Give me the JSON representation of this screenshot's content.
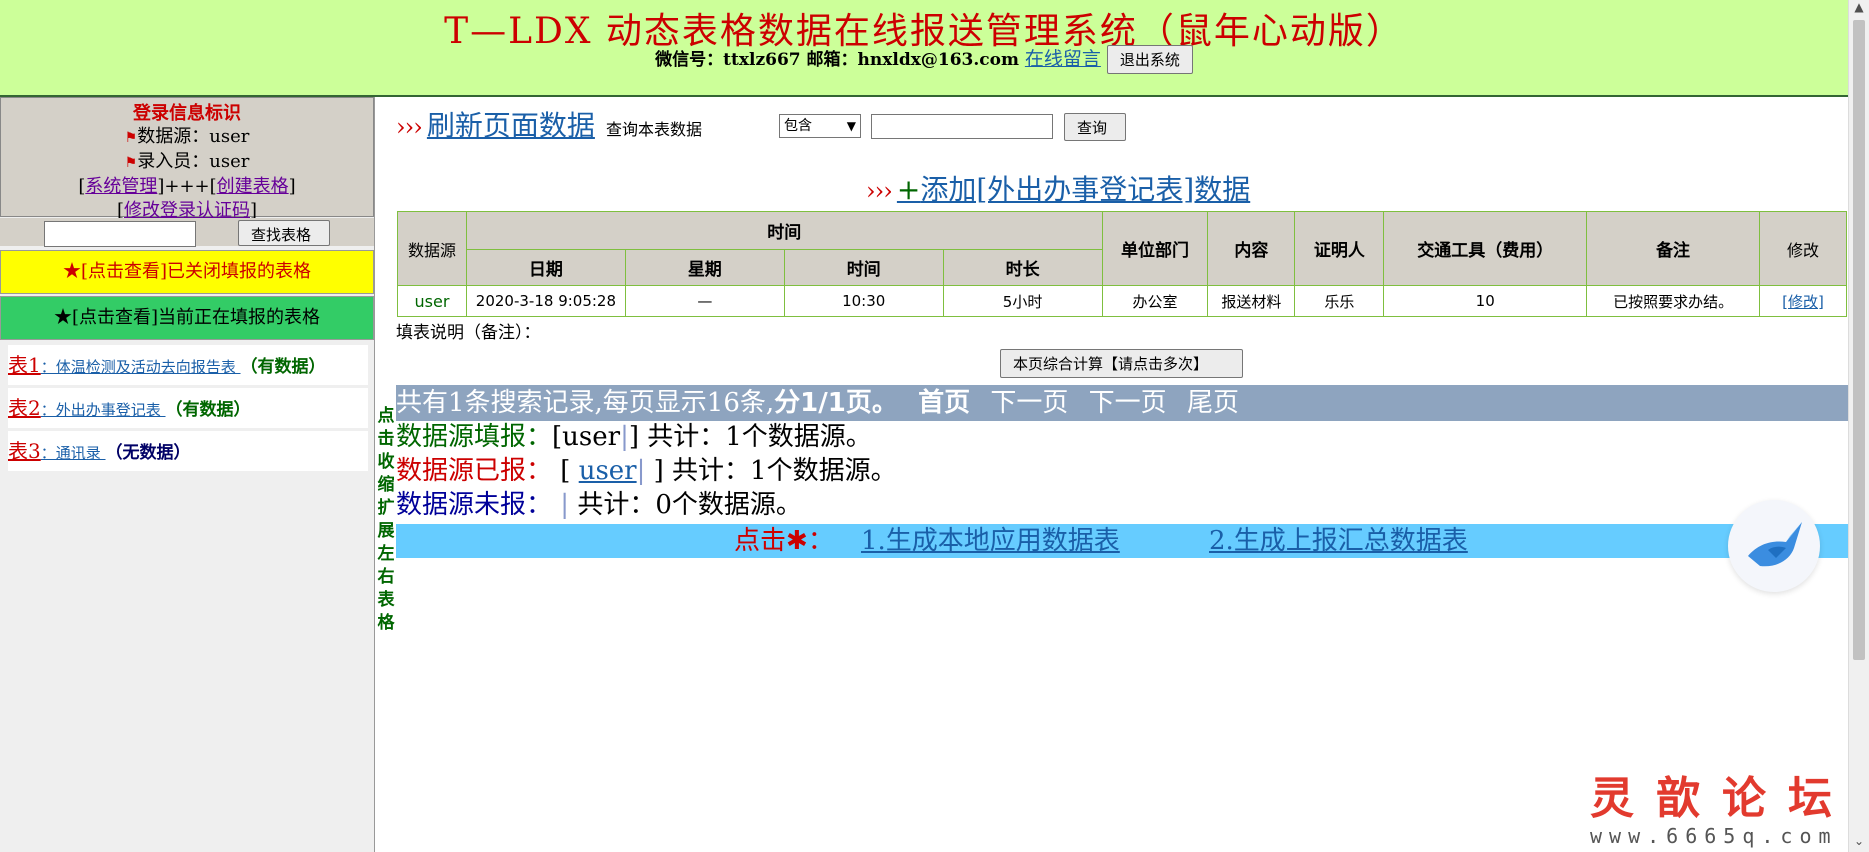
{
  "header": {
    "title": "T—LDX 动态表格数据在线报送管理系统（鼠年心动版）",
    "contact": "微信号：ttxlz667 邮箱：hnxldx@163.com",
    "message_link": "在线留言",
    "logout_button": "退出系统"
  },
  "sidebar": {
    "login_title": "登录信息标识",
    "datasource_label": "数据源：user",
    "operator_label": "录入员：user",
    "admin_links": {
      "open_bracket": "[",
      "system_admin": "系统管理",
      "mid": "]+++[",
      "create_table": "创建表格",
      "close_bracket": "]"
    },
    "change_code": {
      "open": "[",
      "label": "修改登录认证码",
      "close": "]"
    },
    "search_button": "查找表格",
    "closed_forms": "★[点击查看]已关闭填报的表格",
    "open_forms": "★[点击查看]当前正在填报的表格",
    "forms": [
      {
        "no": "表1",
        "name": "：体温检测及活动去向报告表 ",
        "status": "（有数据）",
        "has_data": true
      },
      {
        "no": "表2",
        "name": "：外出办事登记表 ",
        "status": "（有数据）",
        "has_data": true
      },
      {
        "no": "表3",
        "name": "：通讯录 ",
        "status": "（无数据）",
        "has_data": false
      }
    ],
    "collapse_text": "点击收缩扩展左右表格"
  },
  "toolbar": {
    "arrows": "›››",
    "refresh_link": "刷新页面数据",
    "query_label": "查询本表数据",
    "match_select": "包含",
    "query_input": "",
    "query_button": "查询"
  },
  "add_section": {
    "arrows": "›››",
    "plus": "+",
    "link": "添加[外出办事登记表]数据"
  },
  "table": {
    "group_header": "时间",
    "headers": {
      "datasource": "数据源",
      "date": "日期",
      "weekday": "星期",
      "time": "时间",
      "duration": "时长",
      "department": "单位部门",
      "content": "内容",
      "witness": "证明人",
      "transport": "交通工具（费用）",
      "remark": "备注",
      "edit": "修改"
    },
    "rows": [
      {
        "datasource": "user",
        "date": "2020-3-18 9:05:28",
        "weekday": "—",
        "time": "10:30",
        "duration": "5小时",
        "department": "办公室",
        "content": "报送材料",
        "witness": "乐乐",
        "transport": "10",
        "remark": "已按照要求办结。",
        "edit": "[修改]"
      }
    ]
  },
  "fill_note": "填表说明（备注）：",
  "calc_button": "本页综合计算【请点击多次】",
  "pager": {
    "summary": "共有1条搜索记录,每页显示16条,",
    "page": "分1/1页。",
    "first": "首页",
    "prev": "下一页",
    "next": "下一页",
    "last": "尾页"
  },
  "stats": {
    "filled_label": "数据源填报：",
    "filled_value": "[user",
    "filled_sep": "|",
    "filled_rest": "] 共计：1个数据源。",
    "reported_label": "数据源已报：",
    "reported_open": " [ ",
    "reported_link": "user",
    "reported_sep": "|",
    "reported_rest": " ] 共计：1个数据源。",
    "unreported_label": "数据源未报：",
    "unreported_sep": " | ",
    "unreported_rest": "共计：0个数据源。"
  },
  "generate": {
    "click_label": "点击",
    "star": "✱",
    "colon": "：",
    "local_link": "1.生成本地应用数据表",
    "summary_link": "2.生成上报汇总数据表"
  },
  "watermark": {
    "title": "灵歆论坛",
    "url": "www.6665q.com"
  },
  "icons": [
    "flag-icon",
    "bird-icon",
    "star-icon",
    "chevron-down-icon"
  ],
  "colors": {
    "header_bg": "#ccff99",
    "title_red": "#cc0000",
    "link_blue": "#1a5fa8",
    "pager_bg": "#8ea4bf",
    "generate_bg": "#66ccff",
    "open_forms_bg": "#33cc66",
    "closed_forms_bg": "#ffff00"
  }
}
